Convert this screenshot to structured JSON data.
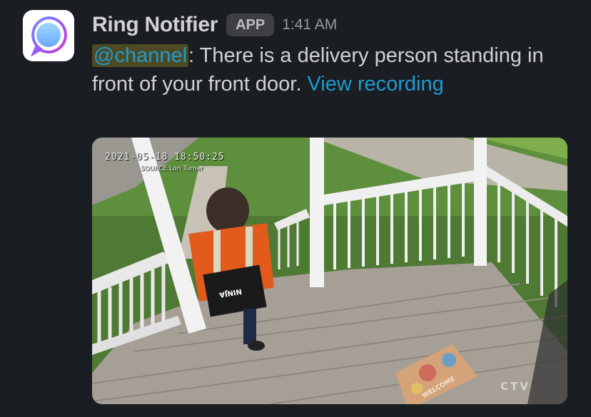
{
  "message": {
    "sender": "Ring Notifier",
    "badge": "APP",
    "time": "1:41 AM",
    "mention": "@channel",
    "text": ": There is a delivery person standing in front of your front door. ",
    "link_text": "View recording",
    "avatar_icon": "ring-logo-icon"
  },
  "attachment": {
    "timestamp_overlay": "2021-05-18  18:50:25",
    "source_overlay": "SOURCE:Lori Turner",
    "box_text": "NINJA",
    "mat_text": "WELCOME",
    "watermark": "CTV"
  },
  "colors": {
    "background": "#1a1d21",
    "text": "#d1d2d3",
    "link": "#1d9bd1",
    "mention_bg": "#4d4a23",
    "badge_bg": "#3d3f43"
  }
}
